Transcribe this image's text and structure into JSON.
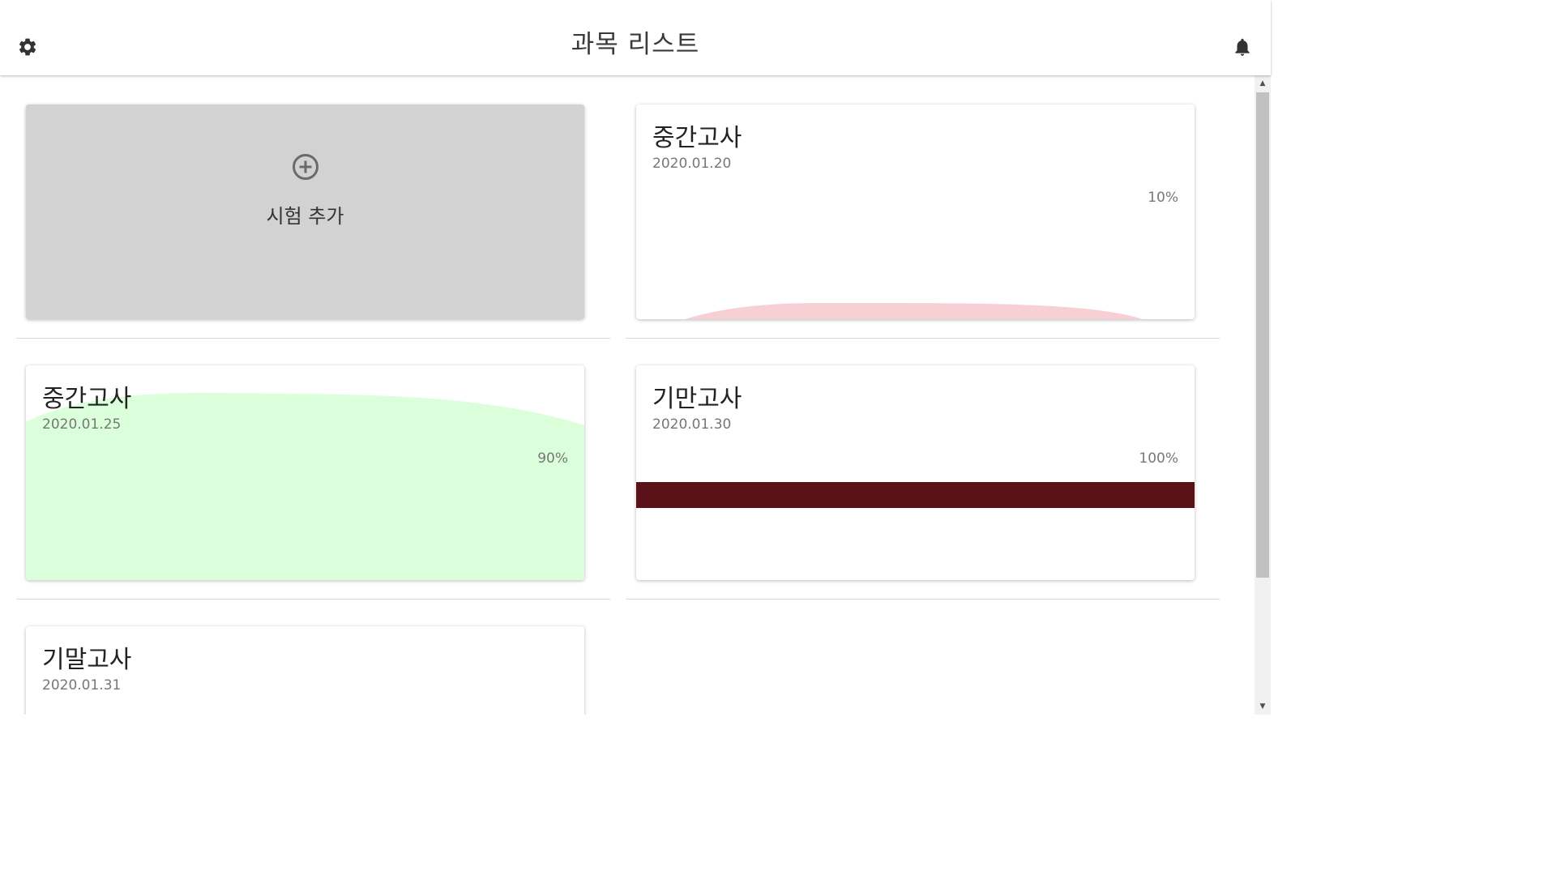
{
  "header": {
    "title": "과목 리스트",
    "left_icon": "gear-icon",
    "right_icon": "bell-icon"
  },
  "add_card": {
    "label": "시험 추가",
    "icon": "plus-circle-icon"
  },
  "exams": [
    {
      "title": "중간고사",
      "date": "2020.01.20",
      "progress_label": "10%",
      "progress": 0.1,
      "style": "wave",
      "color": "#f7d0d6"
    },
    {
      "title": "중간고사",
      "date": "2020.01.25",
      "progress_label": "90%",
      "progress": 0.9,
      "style": "wave",
      "color": "#dbffdb"
    },
    {
      "title": "기만고사",
      "date": "2020.01.30",
      "progress_label": "100%",
      "progress": 1.0,
      "style": "band",
      "color": "#5a1118"
    },
    {
      "title": "기말고사",
      "date": "2020.01.31",
      "progress_label": "",
      "progress": null,
      "style": "none",
      "color": ""
    }
  ],
  "scrollbar": {
    "up_arrow": "▲",
    "down_arrow": "▼"
  },
  "colors": {
    "header_bg": "#ffffff",
    "add_card_bg": "#d2d2d2",
    "title_text": "#222222",
    "meta_text": "#777777"
  }
}
